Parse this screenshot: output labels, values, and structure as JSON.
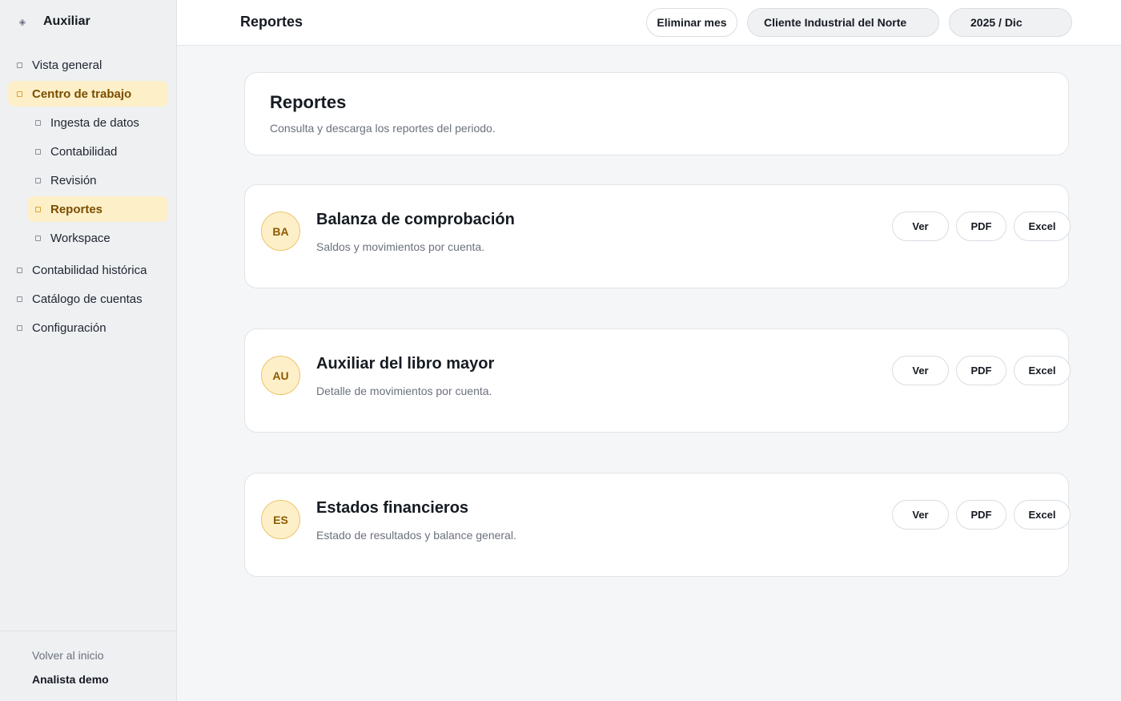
{
  "sidebar": {
    "brand": {
      "name": "Auxiliar",
      "icon": "diamond-icon"
    },
    "items": [
      {
        "label": "Vista general",
        "icon": "square-bullet-icon",
        "active": false
      },
      {
        "label": "Centro de trabajo",
        "icon": "square-bullet-icon",
        "active": true
      },
      {
        "label": "Ingesta de datos",
        "icon": "square-bullet-icon",
        "active": false
      },
      {
        "label": "Contabilidad",
        "icon": "square-bullet-icon",
        "active": false
      },
      {
        "label": "Revisión",
        "icon": "square-bullet-icon",
        "active": false
      },
      {
        "label": "Reportes",
        "icon": "square-bullet-icon",
        "active": true
      },
      {
        "label": "Workspace",
        "icon": "square-bullet-icon",
        "active": false
      },
      {
        "label": "Contabilidad histórica",
        "icon": "square-bullet-icon",
        "active": false
      },
      {
        "label": "Catálogo de cuentas",
        "icon": "square-bullet-icon",
        "active": false
      },
      {
        "label": "Configuración",
        "icon": "square-bullet-icon",
        "active": false
      }
    ],
    "footer": {
      "back_label": "Volver al inicio",
      "user_name": "Analista demo"
    }
  },
  "topbar": {
    "title": "Reportes",
    "delete_month_label": "Eliminar mes",
    "client_selected": "Cliente Industrial del Norte",
    "period_selected": "2025 / Dic"
  },
  "main": {
    "header": {
      "title": "Reportes",
      "description": "Consulta y descarga los reportes del periodo."
    },
    "reports": [
      {
        "initials": "BA",
        "title": "Balanza de comprobación",
        "description": "Saldos y movimientos por cuenta.",
        "actions": {
          "view": "Ver",
          "pdf": "PDF",
          "excel": "Excel"
        }
      },
      {
        "initials": "AU",
        "title": "Auxiliar del libro mayor",
        "description": "Detalle de movimientos por cuenta.",
        "actions": {
          "view": "Ver",
          "pdf": "PDF",
          "excel": "Excel"
        }
      },
      {
        "initials": "ES",
        "title": "Estados financieros",
        "description": "Estado de resultados y balance general.",
        "actions": {
          "view": "Ver",
          "pdf": "PDF",
          "excel": "Excel"
        }
      }
    ]
  },
  "colors": {
    "accent_bg": "#fdefc8",
    "accent_text": "#7a4e00",
    "avatar_border": "#eec46a"
  }
}
